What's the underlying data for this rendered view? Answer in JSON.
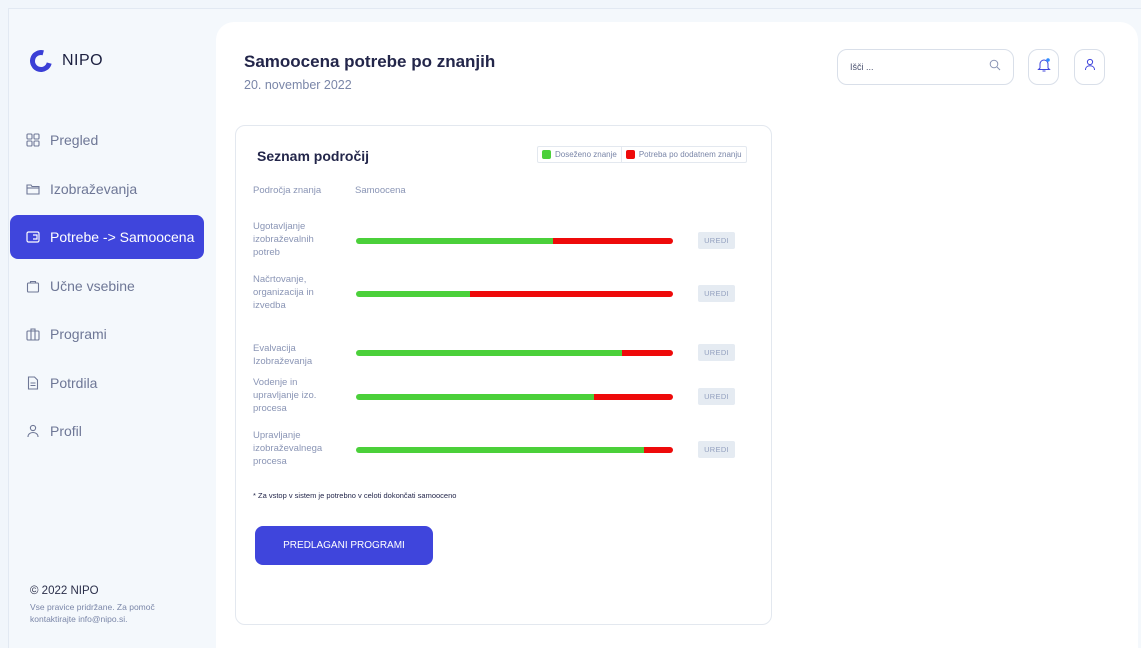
{
  "brand": {
    "name": "NIPO",
    "accent": "#3f45dc"
  },
  "sidebar": {
    "items": [
      {
        "label": "Pregled",
        "icon": "grid-icon",
        "active": false
      },
      {
        "label": "Izobraževanja",
        "icon": "folder-icon",
        "active": false
      },
      {
        "label": "Potrebe -> Samoocena",
        "icon": "card-icon",
        "active": true
      },
      {
        "label": "Učne vsebine",
        "icon": "bag-icon",
        "active": false
      },
      {
        "label": "Programi",
        "icon": "briefcase-icon",
        "active": false
      },
      {
        "label": "Potrdila",
        "icon": "document-icon",
        "active": false
      },
      {
        "label": "Profil",
        "icon": "user-icon",
        "active": false
      }
    ],
    "footer": {
      "copyright": "© 2022 NIPO",
      "rights_line1": "Vse pravice pridržane. Za pomoč",
      "rights_line2": "kontaktirajte info@nipo.si."
    }
  },
  "header": {
    "title": "Samoocena potrebe po znanjih",
    "date": "20. november 2022",
    "search": {
      "placeholder": "Išči ..."
    }
  },
  "card": {
    "title": "Seznam področij",
    "legend": {
      "achieved": {
        "label": "Doseženo znanje",
        "color": "#4bd03a"
      },
      "needed": {
        "label": "Potreba po dodatnem znanju",
        "color": "#ee0a0a"
      }
    },
    "columns": {
      "area": "Področja znanja",
      "self": "Samoocena"
    },
    "rows": [
      {
        "label_lines": [
          "Ugotavljanje",
          "izobraževalnih",
          "potreb"
        ],
        "achieved": 0.62,
        "button": "UREDI"
      },
      {
        "label_lines": [
          "Načrtovanje,",
          "organizacija in",
          "izvedba"
        ],
        "achieved": 0.36,
        "button": "UREDI"
      },
      {
        "label_lines": [
          "Evalvacija",
          "Izobraževanja"
        ],
        "achieved": 0.84,
        "button": "UREDI"
      },
      {
        "label_lines": [
          "Vodenje in",
          "upravljanje izo.",
          "procesa"
        ],
        "achieved": 0.75,
        "button": "UREDI"
      },
      {
        "label_lines": [
          "Upravljanje",
          "izobraževalnega",
          "procesa"
        ],
        "achieved": 0.91,
        "button": "UREDI"
      }
    ],
    "note": "* Za vstop v sistem je potrebno v celoti dokončati samooceno",
    "cta": "PREDLAGANI PROGRAMI"
  }
}
